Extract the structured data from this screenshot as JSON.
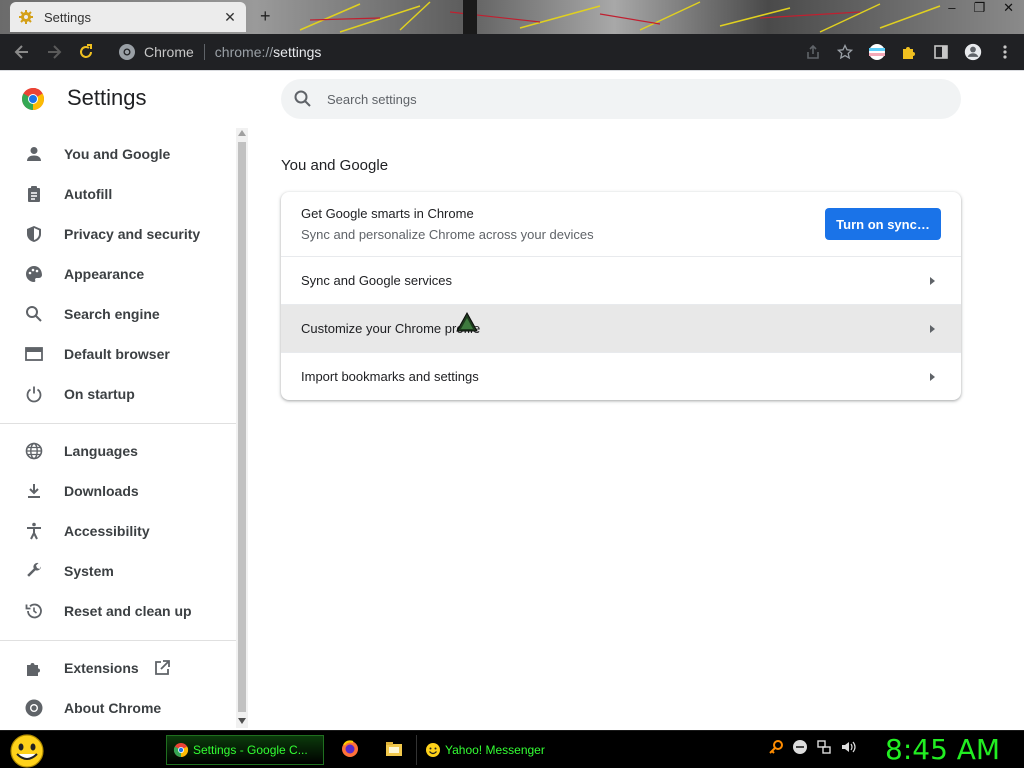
{
  "window": {
    "tab_title": "Settings",
    "tab_close": "✕",
    "new_tab": "+",
    "controls": [
      "–",
      "❐",
      "✕"
    ]
  },
  "toolbar": {
    "site_label": "Chrome",
    "url_scheme": "chrome://",
    "url_path": "settings",
    "icons": [
      "back-icon",
      "forward-icon",
      "reload-icon",
      "share-icon",
      "bookmark-star-icon",
      "profile-flag-icon",
      "extensions-puzzle-icon",
      "side-panel-icon",
      "account-avatar-icon",
      "menu-kebab-icon"
    ]
  },
  "header": {
    "title": "Settings",
    "search_placeholder": "Search settings"
  },
  "sidebar": {
    "group1": [
      {
        "label": "You and Google",
        "icon": "person-icon"
      },
      {
        "label": "Autofill",
        "icon": "clipboard-icon"
      },
      {
        "label": "Privacy and security",
        "icon": "shield-icon"
      },
      {
        "label": "Appearance",
        "icon": "palette-icon"
      },
      {
        "label": "Search engine",
        "icon": "search-icon"
      },
      {
        "label": "Default browser",
        "icon": "browser-window-icon"
      },
      {
        "label": "On startup",
        "icon": "power-icon"
      }
    ],
    "group2": [
      {
        "label": "Languages",
        "icon": "globe-icon"
      },
      {
        "label": "Downloads",
        "icon": "download-icon"
      },
      {
        "label": "Accessibility",
        "icon": "accessibility-icon"
      },
      {
        "label": "System",
        "icon": "wrench-icon"
      },
      {
        "label": "Reset and clean up",
        "icon": "history-icon"
      }
    ],
    "group3": [
      {
        "label": "Extensions",
        "icon": "puzzle-icon"
      },
      {
        "label": "About Chrome",
        "icon": "chrome-icon"
      }
    ]
  },
  "main": {
    "section_title": "You and Google",
    "sync_card": {
      "primary": "Get Google smarts in Chrome",
      "secondary": "Sync and personalize Chrome across your devices",
      "button": "Turn on sync…"
    },
    "rows": [
      {
        "label": "Sync and Google services"
      },
      {
        "label": "Customize your Chrome profile"
      },
      {
        "label": "Import bookmarks and settings"
      }
    ]
  },
  "taskbar": {
    "tasks": [
      {
        "label": "Settings - Google C...",
        "icon": "chrome-icon"
      },
      {
        "label": "Yahoo! Messenger",
        "icon": "smiley-icon"
      }
    ],
    "clock": "8:45 AM"
  },
  "colors": {
    "accent": "#1a73e8",
    "toolbar_bg": "#202124",
    "taskbar_text": "#33ff33",
    "clock": "#22ee22"
  }
}
